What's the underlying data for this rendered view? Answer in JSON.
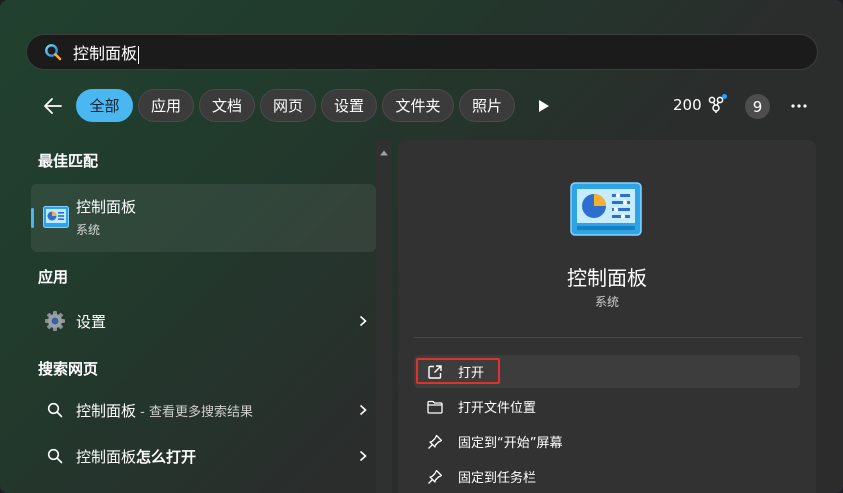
{
  "search": {
    "query": "控制面板"
  },
  "filters": {
    "tabs": [
      {
        "label": "全部",
        "active": true
      },
      {
        "label": "应用"
      },
      {
        "label": "文档"
      },
      {
        "label": "网页"
      },
      {
        "label": "设置"
      },
      {
        "label": "文件夹"
      },
      {
        "label": "照片"
      }
    ],
    "points": "200",
    "avatar": "9"
  },
  "results": {
    "best_match_header": "最佳匹配",
    "best_match": {
      "title": "控制面板",
      "subtitle": "系统"
    },
    "apps_header": "应用",
    "apps": [
      {
        "label": "设置"
      }
    ],
    "web_header": "搜索网页",
    "web": [
      {
        "query": "控制面板",
        "suffix": " - 查看更多搜索结果"
      },
      {
        "prefix": "控制面板",
        "bold": "怎么打开"
      }
    ]
  },
  "detail": {
    "title": "控制面板",
    "subtitle": "系统",
    "actions": [
      {
        "label": "打开"
      },
      {
        "label": "打开文件位置"
      },
      {
        "label": "固定到“开始”屏幕"
      },
      {
        "label": "固定到任务栏"
      }
    ]
  },
  "colors": {
    "accent": "#4bb7f0",
    "highlight_box": "#e0312a"
  }
}
